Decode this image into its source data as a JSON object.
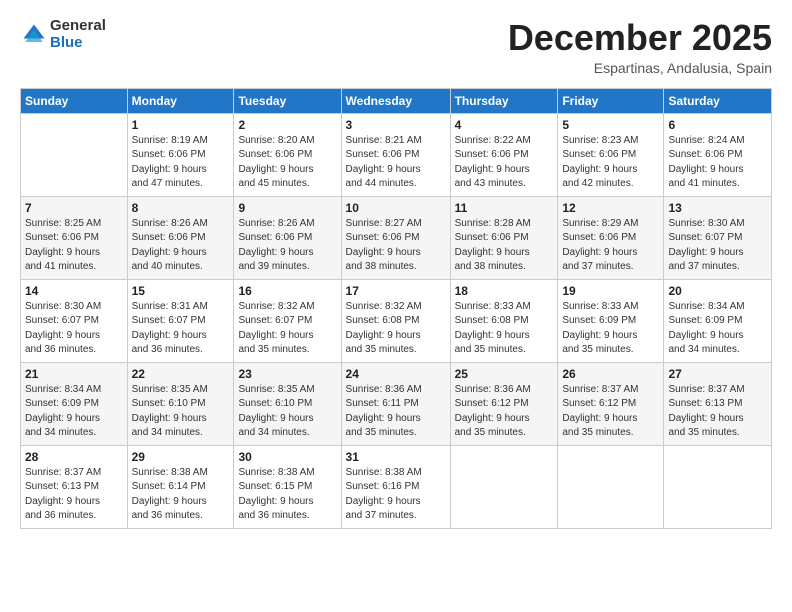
{
  "logo": {
    "general": "General",
    "blue": "Blue"
  },
  "title": "December 2025",
  "location": "Espartinas, Andalusia, Spain",
  "weekdays": [
    "Sunday",
    "Monday",
    "Tuesday",
    "Wednesday",
    "Thursday",
    "Friday",
    "Saturday"
  ],
  "weeks": [
    [
      {
        "day": "",
        "info": ""
      },
      {
        "day": "1",
        "info": "Sunrise: 8:19 AM\nSunset: 6:06 PM\nDaylight: 9 hours\nand 47 minutes."
      },
      {
        "day": "2",
        "info": "Sunrise: 8:20 AM\nSunset: 6:06 PM\nDaylight: 9 hours\nand 45 minutes."
      },
      {
        "day": "3",
        "info": "Sunrise: 8:21 AM\nSunset: 6:06 PM\nDaylight: 9 hours\nand 44 minutes."
      },
      {
        "day": "4",
        "info": "Sunrise: 8:22 AM\nSunset: 6:06 PM\nDaylight: 9 hours\nand 43 minutes."
      },
      {
        "day": "5",
        "info": "Sunrise: 8:23 AM\nSunset: 6:06 PM\nDaylight: 9 hours\nand 42 minutes."
      },
      {
        "day": "6",
        "info": "Sunrise: 8:24 AM\nSunset: 6:06 PM\nDaylight: 9 hours\nand 41 minutes."
      }
    ],
    [
      {
        "day": "7",
        "info": "Sunrise: 8:25 AM\nSunset: 6:06 PM\nDaylight: 9 hours\nand 41 minutes."
      },
      {
        "day": "8",
        "info": "Sunrise: 8:26 AM\nSunset: 6:06 PM\nDaylight: 9 hours\nand 40 minutes."
      },
      {
        "day": "9",
        "info": "Sunrise: 8:26 AM\nSunset: 6:06 PM\nDaylight: 9 hours\nand 39 minutes."
      },
      {
        "day": "10",
        "info": "Sunrise: 8:27 AM\nSunset: 6:06 PM\nDaylight: 9 hours\nand 38 minutes."
      },
      {
        "day": "11",
        "info": "Sunrise: 8:28 AM\nSunset: 6:06 PM\nDaylight: 9 hours\nand 38 minutes."
      },
      {
        "day": "12",
        "info": "Sunrise: 8:29 AM\nSunset: 6:06 PM\nDaylight: 9 hours\nand 37 minutes."
      },
      {
        "day": "13",
        "info": "Sunrise: 8:30 AM\nSunset: 6:07 PM\nDaylight: 9 hours\nand 37 minutes."
      }
    ],
    [
      {
        "day": "14",
        "info": "Sunrise: 8:30 AM\nSunset: 6:07 PM\nDaylight: 9 hours\nand 36 minutes."
      },
      {
        "day": "15",
        "info": "Sunrise: 8:31 AM\nSunset: 6:07 PM\nDaylight: 9 hours\nand 36 minutes."
      },
      {
        "day": "16",
        "info": "Sunrise: 8:32 AM\nSunset: 6:07 PM\nDaylight: 9 hours\nand 35 minutes."
      },
      {
        "day": "17",
        "info": "Sunrise: 8:32 AM\nSunset: 6:08 PM\nDaylight: 9 hours\nand 35 minutes."
      },
      {
        "day": "18",
        "info": "Sunrise: 8:33 AM\nSunset: 6:08 PM\nDaylight: 9 hours\nand 35 minutes."
      },
      {
        "day": "19",
        "info": "Sunrise: 8:33 AM\nSunset: 6:09 PM\nDaylight: 9 hours\nand 35 minutes."
      },
      {
        "day": "20",
        "info": "Sunrise: 8:34 AM\nSunset: 6:09 PM\nDaylight: 9 hours\nand 34 minutes."
      }
    ],
    [
      {
        "day": "21",
        "info": "Sunrise: 8:34 AM\nSunset: 6:09 PM\nDaylight: 9 hours\nand 34 minutes."
      },
      {
        "day": "22",
        "info": "Sunrise: 8:35 AM\nSunset: 6:10 PM\nDaylight: 9 hours\nand 34 minutes."
      },
      {
        "day": "23",
        "info": "Sunrise: 8:35 AM\nSunset: 6:10 PM\nDaylight: 9 hours\nand 34 minutes."
      },
      {
        "day": "24",
        "info": "Sunrise: 8:36 AM\nSunset: 6:11 PM\nDaylight: 9 hours\nand 35 minutes."
      },
      {
        "day": "25",
        "info": "Sunrise: 8:36 AM\nSunset: 6:12 PM\nDaylight: 9 hours\nand 35 minutes."
      },
      {
        "day": "26",
        "info": "Sunrise: 8:37 AM\nSunset: 6:12 PM\nDaylight: 9 hours\nand 35 minutes."
      },
      {
        "day": "27",
        "info": "Sunrise: 8:37 AM\nSunset: 6:13 PM\nDaylight: 9 hours\nand 35 minutes."
      }
    ],
    [
      {
        "day": "28",
        "info": "Sunrise: 8:37 AM\nSunset: 6:13 PM\nDaylight: 9 hours\nand 36 minutes."
      },
      {
        "day": "29",
        "info": "Sunrise: 8:38 AM\nSunset: 6:14 PM\nDaylight: 9 hours\nand 36 minutes."
      },
      {
        "day": "30",
        "info": "Sunrise: 8:38 AM\nSunset: 6:15 PM\nDaylight: 9 hours\nand 36 minutes."
      },
      {
        "day": "31",
        "info": "Sunrise: 8:38 AM\nSunset: 6:16 PM\nDaylight: 9 hours\nand 37 minutes."
      },
      {
        "day": "",
        "info": ""
      },
      {
        "day": "",
        "info": ""
      },
      {
        "day": "",
        "info": ""
      }
    ]
  ]
}
